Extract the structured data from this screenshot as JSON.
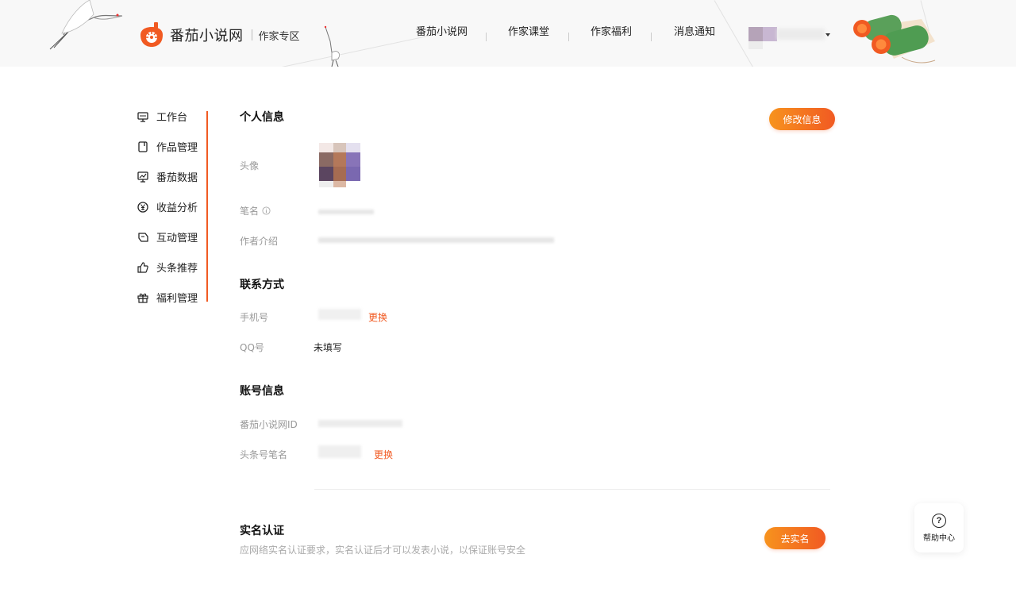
{
  "header": {
    "logo_text": "番茄小说网",
    "logo_sub": "作家专区",
    "nav": [
      "番茄小说网",
      "作家课堂",
      "作家福利",
      "消息通知"
    ]
  },
  "sidebar": {
    "items": [
      {
        "label": "工作台",
        "icon": "monitor-icon"
      },
      {
        "label": "作品管理",
        "icon": "book-icon"
      },
      {
        "label": "番茄数据",
        "icon": "chart-icon"
      },
      {
        "label": "收益分析",
        "icon": "yuan-icon"
      },
      {
        "label": "互动管理",
        "icon": "chat-icon"
      },
      {
        "label": "头条推荐",
        "icon": "thumb-up-icon"
      },
      {
        "label": "福利管理",
        "icon": "gift-icon"
      }
    ]
  },
  "profile": {
    "title": "个人信息",
    "edit_button": "修改信息",
    "avatar_label": "头像",
    "penname_label": "笔名",
    "intro_label": "作者介绍"
  },
  "contact": {
    "title": "联系方式",
    "phone_label": "手机号",
    "phone_change": "更换",
    "qq_label": "QQ号",
    "qq_value": "未填写"
  },
  "account": {
    "title": "账号信息",
    "id_label": "番茄小说网ID",
    "toutiao_label": "头条号笔名",
    "toutiao_change": "更换"
  },
  "realname": {
    "title": "实名认证",
    "desc": "应网络实名认证要求，实名认证后才可以发表小说，以保证账号安全",
    "button": "去实名"
  },
  "help": {
    "icon_text": "?",
    "label": "帮助中心"
  },
  "colors": {
    "accent": "#f15a22",
    "accent_light": "#f7931e"
  }
}
